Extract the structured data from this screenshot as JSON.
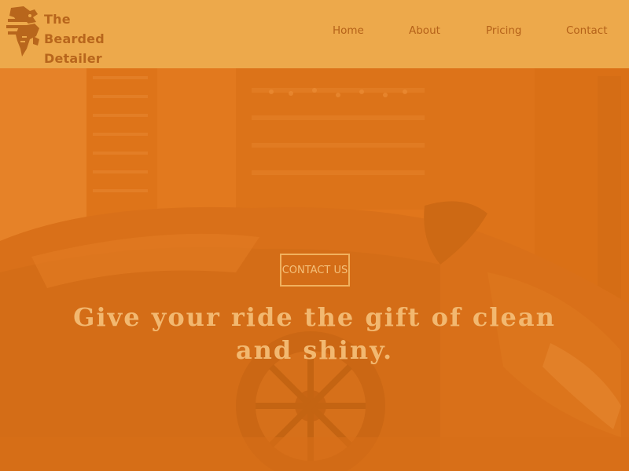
{
  "brand": {
    "name_line1": "The Bearded",
    "name_line2": "Detailer",
    "logo_icon": "bearded-man-logo-icon",
    "text_color": "#b8661c"
  },
  "nav": {
    "items": [
      {
        "label": "Home"
      },
      {
        "label": "About"
      },
      {
        "label": "Pricing"
      },
      {
        "label": "Contact"
      }
    ],
    "color": "#b56219"
  },
  "hero": {
    "cta_label": "CONTACT US",
    "headline": "Give your ride the gift of clean and shiny.",
    "overlay_color": "#e87c1e",
    "header_bg": "#eda94b",
    "accent_text": "#f2b870"
  }
}
